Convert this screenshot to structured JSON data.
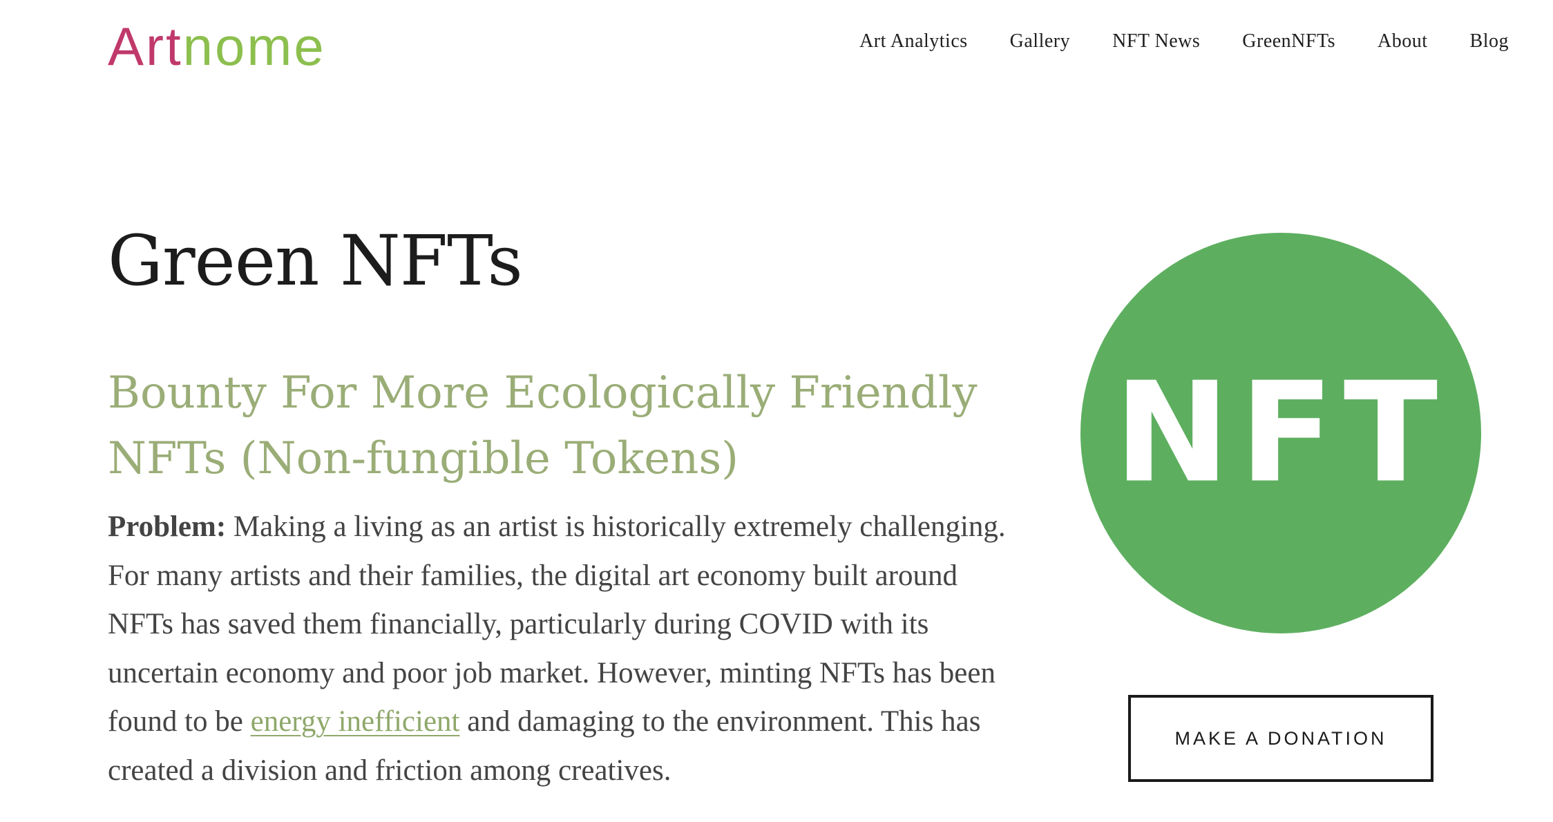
{
  "header": {
    "logo": {
      "part1": "Art",
      "part2": "nome"
    },
    "nav": [
      {
        "label": "Art Analytics"
      },
      {
        "label": "Gallery"
      },
      {
        "label": "NFT News"
      },
      {
        "label": "GreenNFTs"
      },
      {
        "label": "About"
      },
      {
        "label": "Blog"
      }
    ]
  },
  "main": {
    "title": "Green NFTs",
    "subtitle": "Bounty For More Ecologically Friendly NFTs (Non-fungible Tokens)",
    "body": {
      "lead": "Problem:",
      "text_before_link": " Making a living as an artist is historically extremely challenging. For many artists and their families, the digital art economy built around NFTs has saved them financially, particularly during COVID with its uncertain economy and poor job market. However, minting NFTs has been found to be ",
      "link_text": "energy inefficient",
      "text_after_link": " and damaging to the environment. This has created a division and friction among creatives."
    }
  },
  "sidebar": {
    "nft_logo_text": "NFT",
    "donate_label": "MAKE A DONATION"
  },
  "colors": {
    "logo_art": "#c0396b",
    "logo_nome": "#8cbf4e",
    "subtitle": "#9aad77",
    "link": "#8fa86b",
    "nft_circle": "#5daf5f"
  }
}
